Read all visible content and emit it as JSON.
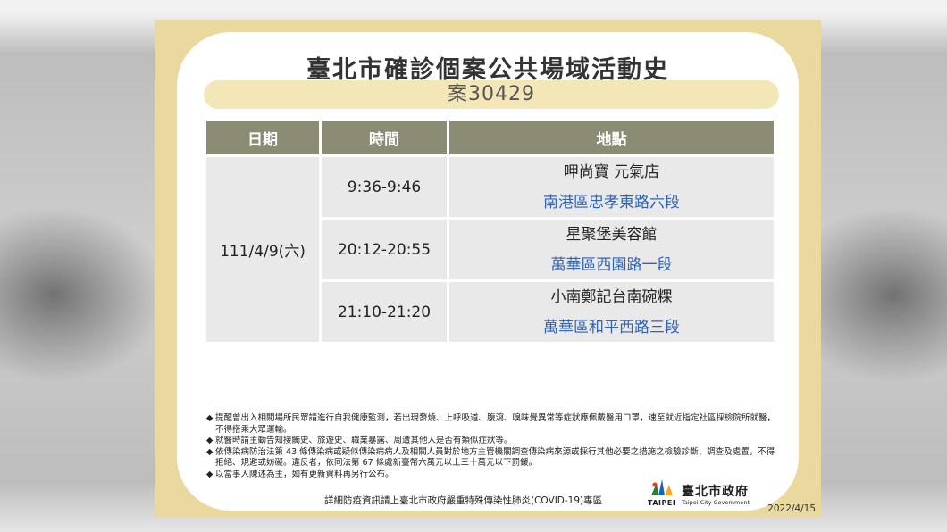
{
  "title": "臺北市確診個案公共場域活動史",
  "case_label": "案30429",
  "table": {
    "headers": [
      "日期",
      "時間",
      "地點"
    ],
    "date": "111/4/9(六)",
    "rows": [
      {
        "time": "9:36-9:46",
        "place": "呷尚寶 元氣店",
        "address": "南港區忠孝東路六段"
      },
      {
        "time": "20:12-20:55",
        "place": "星聚堡美容館",
        "address": "萬華區西園路一段"
      },
      {
        "time": "21:10-21:20",
        "place": "小南鄭記台南碗粿",
        "address": "萬華區和平西路三段"
      }
    ]
  },
  "notes": [
    "提醒曾出入相關場所民眾請進行自我健康監測，若出現發燒、上呼吸道、腹瀉、嗅味覺異常等症狀應佩戴醫用口罩，速至就近指定社區採檢院所就醫，不得搭乘大眾運輸。",
    "就醫時請主動告知接觸史、旅遊史、職業暴露、周遭其他人是否有類似症狀等。",
    "依傳染病防治法第 43 條傳染病或疑似傳染病病人及相關人員對於地方主管機關調查傳染病來源或採行其他必要之措施之檢驗診斷、調查及處置，不得拒絕、規避或妨礙。違反者，依同法第 67 條處新臺幣六萬元以上三十萬元以下罰鍰。",
    "以當事人陳述為主，如有更新資料再另行公布。"
  ],
  "note_bullet": "◆",
  "footer": "詳細防疫資訊請上臺北市政府嚴重特殊傳染性肺炎(COVID-19)專區",
  "logo": {
    "wordmark": "TAIPEI",
    "name": "臺北市政府",
    "english": "Taipei City Government"
  },
  "date_stamp": "2022/4/15",
  "colors": {
    "card": "#ead99f",
    "header": "#8c8c74",
    "cell": "#e9e9e9",
    "address": "#2e63b8",
    "subtitle_bar": "#f3e7b8"
  }
}
